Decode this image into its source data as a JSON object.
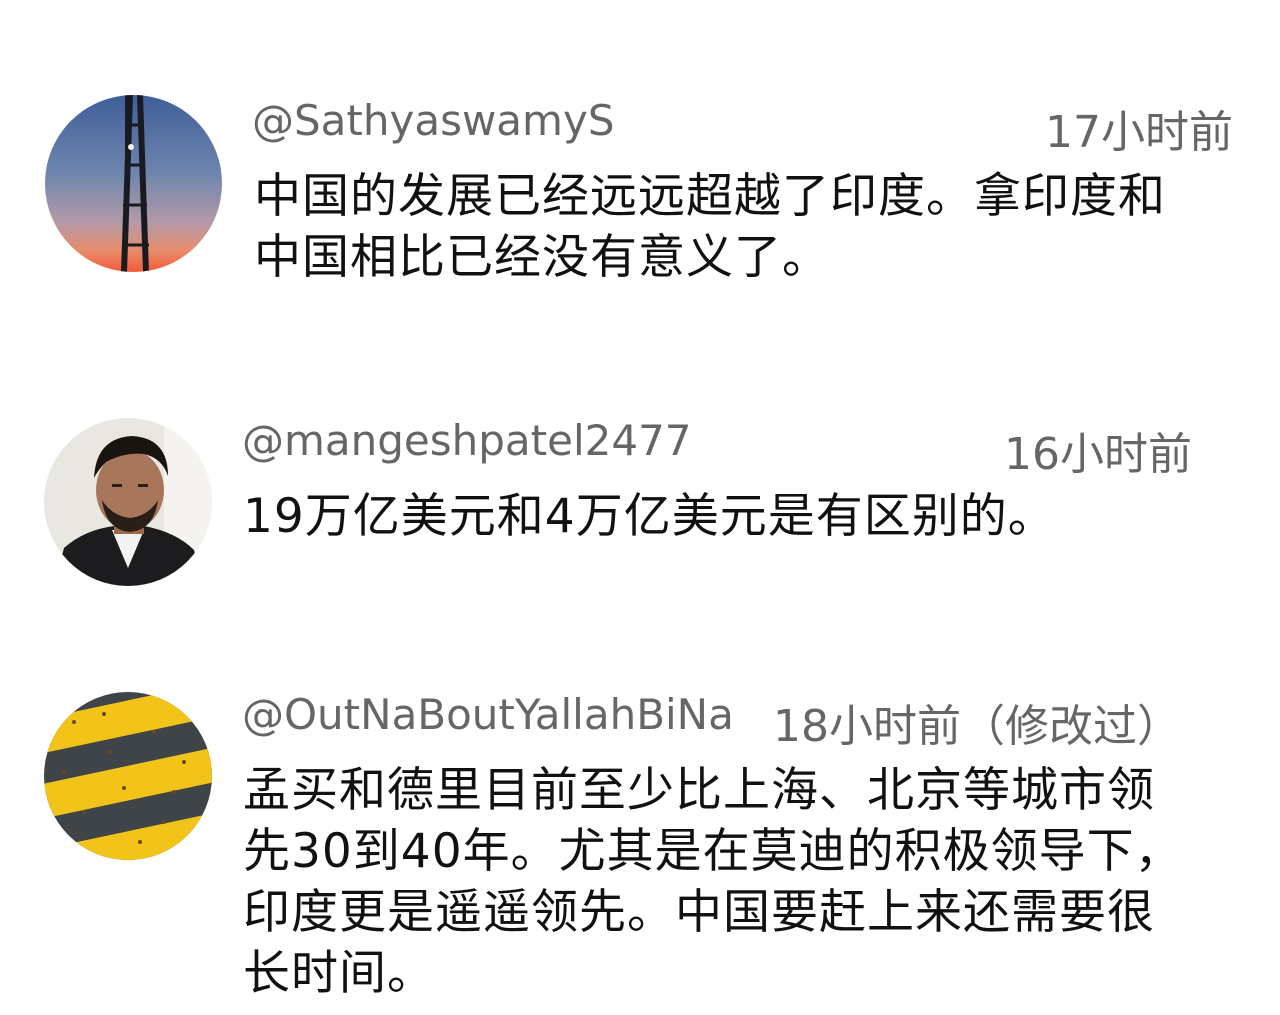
{
  "comments": [
    {
      "handle": "@SathyaswamyS",
      "time": "17小时前",
      "lines": [
        "中国的发展已经远远超越了印度。拿印度和",
        "中国相比已经没有意义了。"
      ],
      "avatar_icon": "sunset-avatar"
    },
    {
      "handle": "@mangeshpatel2477",
      "time": "16小时前",
      "lines": [
        "19万亿美元和4万亿美元是有区别的。"
      ],
      "avatar_icon": "person-photo-avatar"
    },
    {
      "handle": "@OutNaBoutYallahBiNa",
      "time": "18小时前（修改过）",
      "lines": [
        "孟买和德里目前至少比上海、北京等城市领",
        "先30到40年。尤其是在莫迪的积极领导下，",
        "印度更是遥遥领先。中国要赶上来还需要很",
        "长时间。"
      ],
      "avatar_icon": "road-stripes-avatar"
    }
  ],
  "colors": {
    "meta_text": "#666666",
    "body_text": "#111111",
    "background": "#ffffff"
  }
}
